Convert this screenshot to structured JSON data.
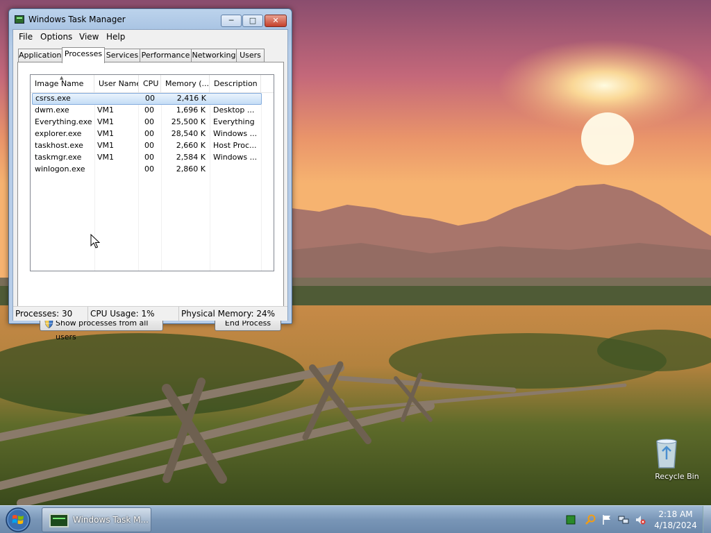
{
  "window": {
    "title": "Windows Task Manager",
    "menu": [
      "File",
      "Options",
      "View",
      "Help"
    ],
    "tabs": [
      "Applications",
      "Processes",
      "Services",
      "Performance",
      "Networking",
      "Users"
    ],
    "active_tab": "Processes"
  },
  "processes": {
    "columns": [
      "Image Name",
      "User Name",
      "CPU",
      "Memory (...",
      "Description"
    ],
    "rows": [
      {
        "name": "csrss.exe",
        "user": "",
        "cpu": "00",
        "mem": "2,416 K",
        "desc": ""
      },
      {
        "name": "dwm.exe",
        "user": "VM1",
        "cpu": "00",
        "mem": "1,696 K",
        "desc": "Desktop ..."
      },
      {
        "name": "Everything.exe",
        "user": "VM1",
        "cpu": "00",
        "mem": "25,500 K",
        "desc": "Everything"
      },
      {
        "name": "explorer.exe",
        "user": "VM1",
        "cpu": "00",
        "mem": "28,540 K",
        "desc": "Windows ..."
      },
      {
        "name": "taskhost.exe",
        "user": "VM1",
        "cpu": "00",
        "mem": "2,660 K",
        "desc": "Host Proc..."
      },
      {
        "name": "taskmgr.exe",
        "user": "VM1",
        "cpu": "00",
        "mem": "2,584 K",
        "desc": "Windows ..."
      },
      {
        "name": "winlogon.exe",
        "user": "",
        "cpu": "00",
        "mem": "2,860 K",
        "desc": ""
      }
    ],
    "selected_row": 0,
    "show_all_label": "Show processes from all users",
    "end_process_label": "End Process"
  },
  "status": {
    "processes": "Processes: 30",
    "cpu": "CPU Usage: 1%",
    "memory": "Physical Memory: 24%"
  },
  "desktop": {
    "recycle_bin_label": "Recycle Bin"
  },
  "taskbar": {
    "task_label": "Windows Task M...",
    "time": "2:18 AM",
    "date": "4/18/2024"
  }
}
